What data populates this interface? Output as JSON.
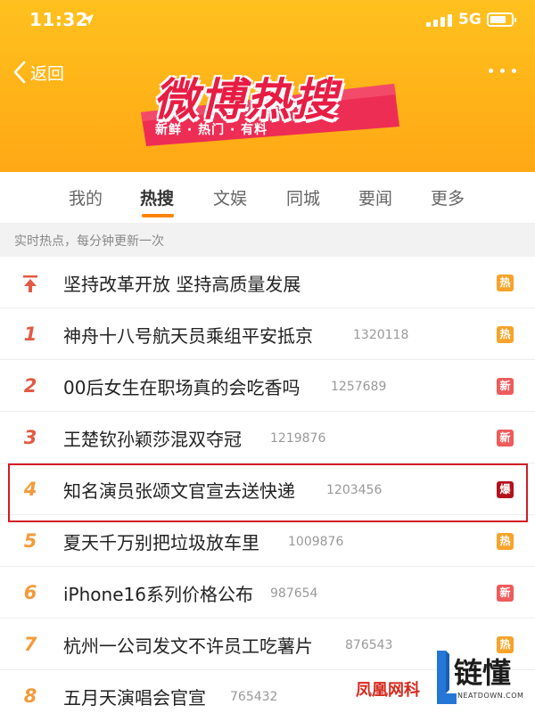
{
  "status_bar": {
    "time": "11:32",
    "network": "5G"
  },
  "nav": {
    "back_label": "返回"
  },
  "banner": {
    "title": "微博热搜",
    "subtitle": "新鲜 · 热门 · 有料"
  },
  "tabs": [
    {
      "label": "我的",
      "active": false
    },
    {
      "label": "热搜",
      "active": true
    },
    {
      "label": "文娱",
      "active": false
    },
    {
      "label": "同城",
      "active": false
    },
    {
      "label": "要闻",
      "active": false
    },
    {
      "label": "更多",
      "active": false
    }
  ],
  "notice": "实时热点，每分钟更新一次",
  "colors": {
    "accent": "#ff8200",
    "header": "#ffb318",
    "rank_top": "#e25a43",
    "rank_mid": "#f29b3a",
    "badge_hot": "#f7a32a",
    "badge_new": "#ef5b5b",
    "badge_boom": "#b2131a",
    "highlight_border": "#d11c26"
  },
  "hot_list": [
    {
      "rank": "",
      "pinned": true,
      "title": "坚持改革开放 坚持高质量发展",
      "count": "",
      "badge": "热",
      "badge_type": "hot"
    },
    {
      "rank": "1",
      "title": "神舟十八号航天员乘组平安抵京",
      "count": "1320118",
      "badge": "热",
      "badge_type": "hot"
    },
    {
      "rank": "2",
      "title": "00后女生在职场真的会吃香吗",
      "count": "1257689",
      "badge": "新",
      "badge_type": "new"
    },
    {
      "rank": "3",
      "title": "王楚钦孙颖莎混双夺冠",
      "count": "1219876",
      "badge": "新",
      "badge_type": "new"
    },
    {
      "rank": "4",
      "title": "知名演员张颂文官宣去送快递",
      "count": "1203456",
      "badge": "爆",
      "badge_type": "boom",
      "highlighted": true
    },
    {
      "rank": "5",
      "title": "夏天千万别把垃圾放车里",
      "count": "1009876",
      "badge": "热",
      "badge_type": "hot"
    },
    {
      "rank": "6",
      "title": "iPhone16系列价格公布",
      "count": "987654",
      "badge": "新",
      "badge_type": "new"
    },
    {
      "rank": "7",
      "title": "杭州一公司发文不许员工吃薯片",
      "count": "876543",
      "badge": "热",
      "badge_type": "hot"
    },
    {
      "rank": "8",
      "title": "五月天演唱会官宣",
      "count": "765432",
      "badge": "",
      "badge_type": ""
    }
  ],
  "watermark": {
    "left_text": "凤凰网科",
    "logo_cn": "链懂",
    "logo_en": "NEATDOWN.COM"
  }
}
